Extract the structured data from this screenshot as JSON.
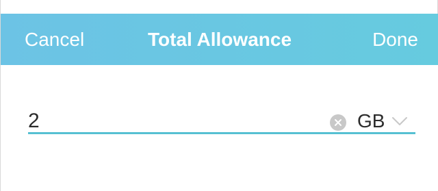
{
  "header": {
    "cancel_label": "Cancel",
    "title": "Total Allowance",
    "done_label": "Done"
  },
  "allowance": {
    "value": "2",
    "unit": "GB",
    "clear_icon": "clear-circle-icon",
    "chevron_icon": "chevron-down-icon"
  },
  "colors": {
    "header_start": "#6cc3e5",
    "header_end": "#66cbdf",
    "accent_line": "#55c0d2",
    "text": "#2b2b2b",
    "icon_gray": "#c8c8c8"
  }
}
